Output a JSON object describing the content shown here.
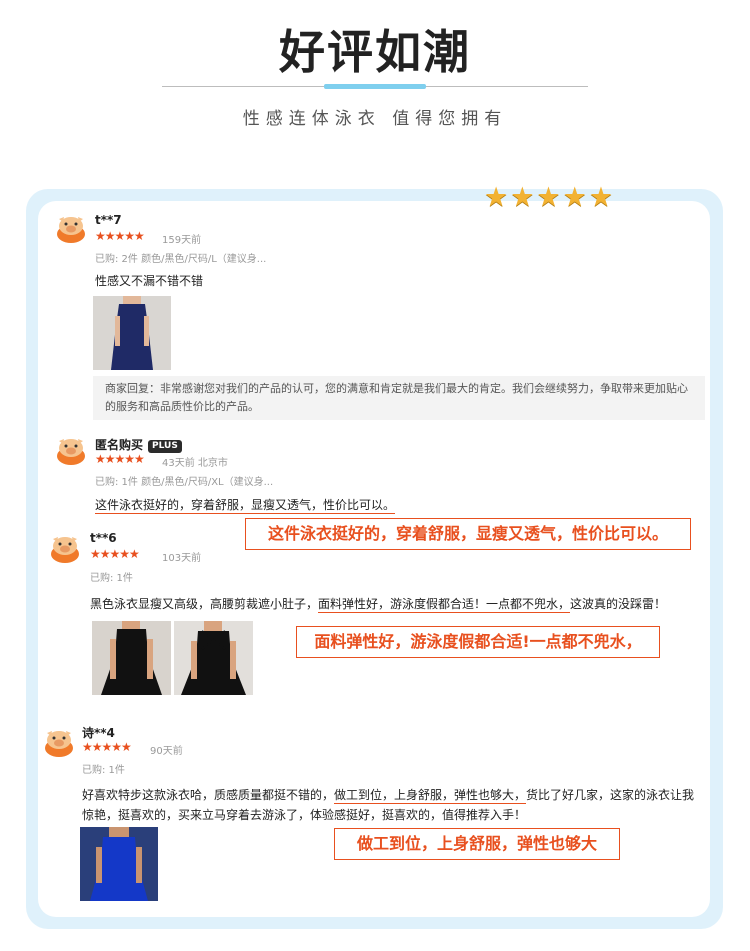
{
  "header": {
    "title": "好评如潮",
    "subtitle": "性感连体泳衣  值得您拥有"
  },
  "rating_stars": "★★★★★",
  "reviews": [
    {
      "user": "t**7",
      "stars": "★★★★★",
      "meta": "159天前",
      "bought": "已购: 2件 颜色/黑色/尺码/L（建议身...",
      "text": "性感又不漏不错不错",
      "photo_colors": [
        "#1f2a66"
      ],
      "reply": "商家回复：非常感谢您对我们的产品的认可，您的满意和肯定就是我们最大的肯定。我们会继续努力，争取带来更加贴心的服务和高品质性价比的产品。"
    },
    {
      "user": "匿名购买",
      "badge": "PLUS",
      "stars": "★★★★★",
      "meta": "43天前   北京市",
      "bought": "已购: 1件 颜色/黑色/尺码/XL（建议身...",
      "text": "这件泳衣挺好的，穿着舒服，显瘦又透气，性价比可以。",
      "callout": "这件泳衣挺好的，穿着舒服，显瘦又透气，性价比可以。"
    },
    {
      "user": "t**6",
      "stars": "★★★★★",
      "meta": "103天前",
      "bought": "已购: 1件",
      "text_before": "黑色泳衣显瘦又高级，高腰剪裁遮小肚子，",
      "text_highlight": "面料弹性好，游泳度假都合适！一点都不兜水，",
      "text_after": "这波真的没踩雷！",
      "photo_colors": [
        "#111111",
        "#111111"
      ],
      "callout": "面料弹性好，游泳度假都合适!一点都不兜水，"
    },
    {
      "user": "诗**4",
      "stars": "★★★★★",
      "meta": "90天前",
      "bought": "已购: 1件",
      "text_before": "好喜欢特步这款泳衣哈，质感质量都挺不错的，",
      "text_highlight": "做工到位，上身舒服，弹性也够大，",
      "text_after": "货比了好几家，这家的泳衣让我",
      "text_line2": "惊艳，挺喜欢的，买来立马穿着去游泳了，体验感挺好，挺喜欢的，值得推荐入手！",
      "photo_colors": [
        "#1438c8"
      ],
      "callout": "做工到位，上身舒服，弹性也够大"
    }
  ]
}
